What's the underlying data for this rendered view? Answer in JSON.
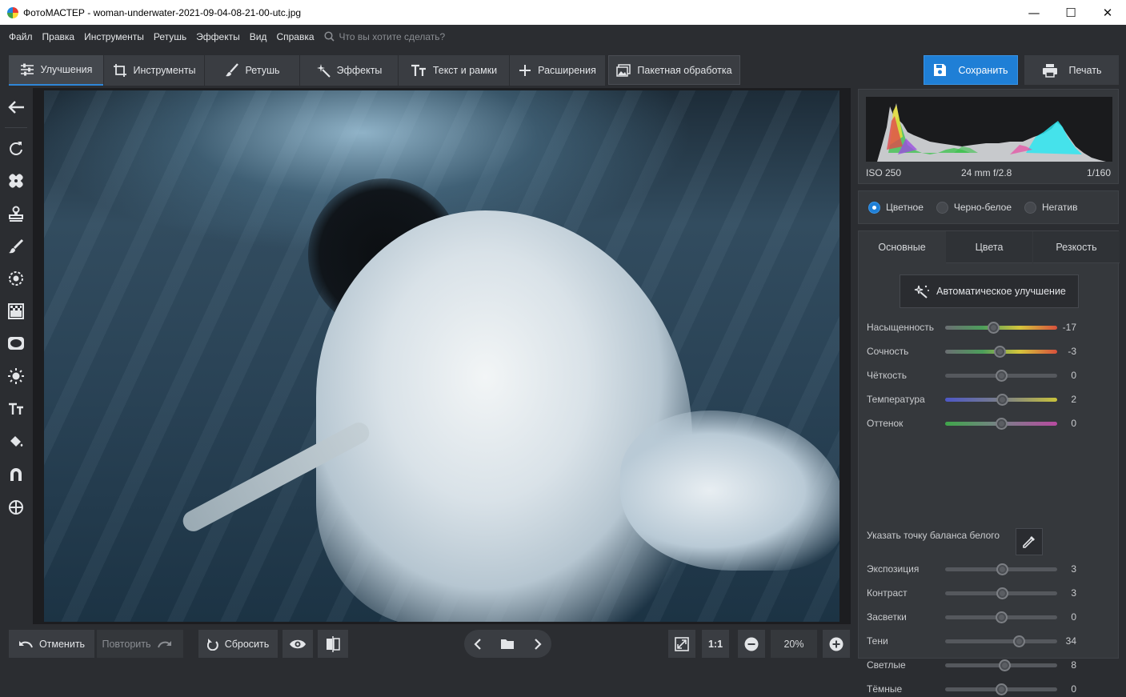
{
  "window": {
    "title": "ФотоМАСТЕР - woman-underwater-2021-09-04-08-21-00-utc.jpg",
    "min": "—",
    "max": "☐",
    "close": "✕"
  },
  "menu": {
    "items": [
      "Файл",
      "Правка",
      "Инструменты",
      "Ретушь",
      "Эффекты",
      "Вид",
      "Справка"
    ],
    "search_placeholder": "Что вы хотите сделать?"
  },
  "tabs": [
    {
      "label": "Улучшения",
      "icon": "sliders-icon"
    },
    {
      "label": "Инструменты",
      "icon": "crop-icon"
    },
    {
      "label": "Ретушь",
      "icon": "brush-icon"
    },
    {
      "label": "Эффекты",
      "icon": "sparkle-icon"
    },
    {
      "label": "Текст и рамки",
      "icon": "text-icon"
    },
    {
      "label": "Расширения",
      "icon": "plus-icon"
    }
  ],
  "batch_label": "Пакетная обработка",
  "save_label": "Сохранить",
  "print_label": "Печать",
  "exif": {
    "iso": "ISO 250",
    "lens": "24 mm f/2.8",
    "shutter": "1/160"
  },
  "modes": [
    {
      "label": "Цветное",
      "selected": true
    },
    {
      "label": "Черно-белое",
      "selected": false
    },
    {
      "label": "Негатив",
      "selected": false
    }
  ],
  "subtabs": [
    "Основные",
    "Цвета",
    "Резкость"
  ],
  "auto_label": "Автоматическое улучшение",
  "sliders_top": [
    {
      "label": "Насыщенность",
      "value": "-17",
      "pos": 0.43,
      "track": "linear-gradient(90deg,#6b6e73,#4c9e5b,#d5c53c,#d8503c)"
    },
    {
      "label": "Сочность",
      "value": "-3",
      "pos": 0.49,
      "track": "linear-gradient(90deg,#6b6e73,#4c9e5b,#d5c53c,#d8503c)"
    },
    {
      "label": "Чёткость",
      "value": "0",
      "pos": 0.5,
      "track": "#55585d"
    },
    {
      "label": "Температура",
      "value": "2",
      "pos": 0.51,
      "track": "linear-gradient(90deg,#4d57c7,#7a7f89,#c8c23b)"
    },
    {
      "label": "Оттенок",
      "value": "0",
      "pos": 0.5,
      "track": "linear-gradient(90deg,#3fa64a,#7a7f89,#b84aa0)"
    }
  ],
  "wb_label": "Указать точку баланса белого",
  "sliders_bottom": [
    {
      "label": "Экспозиция",
      "value": "3",
      "pos": 0.51
    },
    {
      "label": "Контраст",
      "value": "3",
      "pos": 0.51
    },
    {
      "label": "Засветки",
      "value": "0",
      "pos": 0.5
    },
    {
      "label": "Тени",
      "value": "34",
      "pos": 0.66
    },
    {
      "label": "Светлые",
      "value": "8",
      "pos": 0.53
    },
    {
      "label": "Тёмные",
      "value": "0",
      "pos": 0.5
    }
  ],
  "bottom": {
    "undo": "Отменить",
    "redo": "Повторить",
    "reset": "Сбросить",
    "ratio": "1:1",
    "zoom": "20%"
  },
  "left_tools": [
    "back-arrow-icon",
    "rotate-icon",
    "bandage-icon",
    "stamp-icon",
    "brush-icon",
    "radial-icon",
    "gradient-filter-icon",
    "vignette-icon",
    "light-icon",
    "text-icon",
    "fill-icon",
    "magnet-icon",
    "target-icon"
  ]
}
